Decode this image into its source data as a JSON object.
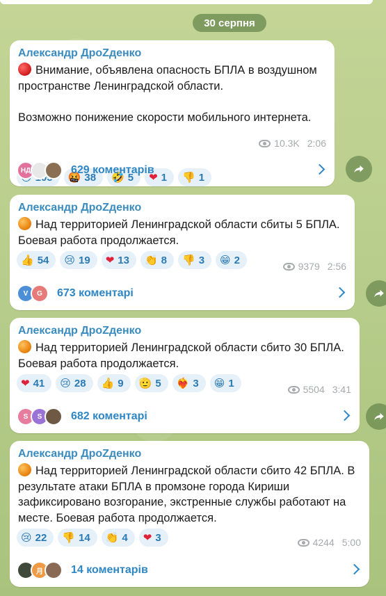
{
  "date_label": "30 серпня",
  "messages": [
    {
      "author": "Александр ДроZденко",
      "dot_color": "red",
      "text": "Внимание, объявлена опасность БПЛА в воздушном пространстве Ленинградской области.\n\nВозможно понижение скорости мобильного интернета.",
      "reactions": [
        {
          "emoji": "😢",
          "count": "105"
        },
        {
          "emoji": "🤬",
          "count": "38"
        },
        {
          "emoji": "🤣",
          "count": "5"
        },
        {
          "emoji": "❤",
          "count": "1"
        },
        {
          "emoji": "👎",
          "count": "1"
        }
      ],
      "views": "10.3K",
      "time": "2:06",
      "avatars": [
        {
          "initials": "НД",
          "color": "#e2719b"
        },
        {
          "initials": "",
          "color": "#d8d8d8"
        },
        {
          "initials": "",
          "color": "#8a6f55"
        }
      ],
      "comments_label": "629 коментарів"
    },
    {
      "author": "Александр ДроZденко",
      "dot_color": "orange",
      "text": "Над территорией Ленинградской области сбиты 5 БПЛА. Боевая работа продолжается.",
      "reactions": [
        {
          "emoji": "👍",
          "count": "54"
        },
        {
          "emoji": "😢",
          "count": "19"
        },
        {
          "emoji": "❤",
          "count": "13"
        },
        {
          "emoji": "👏",
          "count": "8"
        },
        {
          "emoji": "👎",
          "count": "3"
        },
        {
          "emoji": "😁",
          "count": "2"
        }
      ],
      "views": "9379",
      "time": "2:56",
      "avatars": [
        {
          "initials": "V",
          "color": "#4d8fd6"
        },
        {
          "initials": "G",
          "color": "#e57a78"
        }
      ],
      "comments_label": "673 коментарі"
    },
    {
      "author": "Александр ДроZденко",
      "dot_color": "orange",
      "text": "Над территорией Ленинградской области сбито 30 БПЛА. Боевая работа продолжается.",
      "reactions": [
        {
          "emoji": "❤",
          "count": "41"
        },
        {
          "emoji": "😢",
          "count": "28"
        },
        {
          "emoji": "👍",
          "count": "9"
        },
        {
          "emoji": "🫡",
          "count": "5"
        },
        {
          "emoji": "❤‍🔥",
          "count": "3"
        },
        {
          "emoji": "😁",
          "count": "1"
        }
      ],
      "views": "5504",
      "time": "3:41",
      "avatars": [
        {
          "initials": "S",
          "color": "#e67c9e"
        },
        {
          "initials": "S",
          "color": "#9a73d8"
        },
        {
          "initials": "",
          "color": "#6e5a44"
        }
      ],
      "comments_label": "682 коментарі"
    },
    {
      "author": "Александр ДроZденко",
      "dot_color": "orange",
      "text": "Над территорией Ленинградской области сбито 42 БПЛА. В результате атаки БПЛА в промзоне города Кириши зафиксировано возгорание, экстренные службы работают на месте. Боевая работа продолжается.",
      "reactions": [
        {
          "emoji": "😢",
          "count": "22"
        },
        {
          "emoji": "👎",
          "count": "14"
        },
        {
          "emoji": "👏",
          "count": "4"
        },
        {
          "emoji": "❤",
          "count": "3"
        }
      ],
      "views": "4244",
      "time": "5:00",
      "avatars": [
        {
          "initials": "",
          "color": "#3f4a3a"
        },
        {
          "initials": "月",
          "color": "#f09a45"
        },
        {
          "initials": "",
          "color": "#8b6a55"
        }
      ],
      "comments_label": "14 коментарів"
    }
  ],
  "colors": {
    "accent": "#2e86c4",
    "author": "#3a8bbf",
    "reaction_bg": "#e6f0f8"
  }
}
